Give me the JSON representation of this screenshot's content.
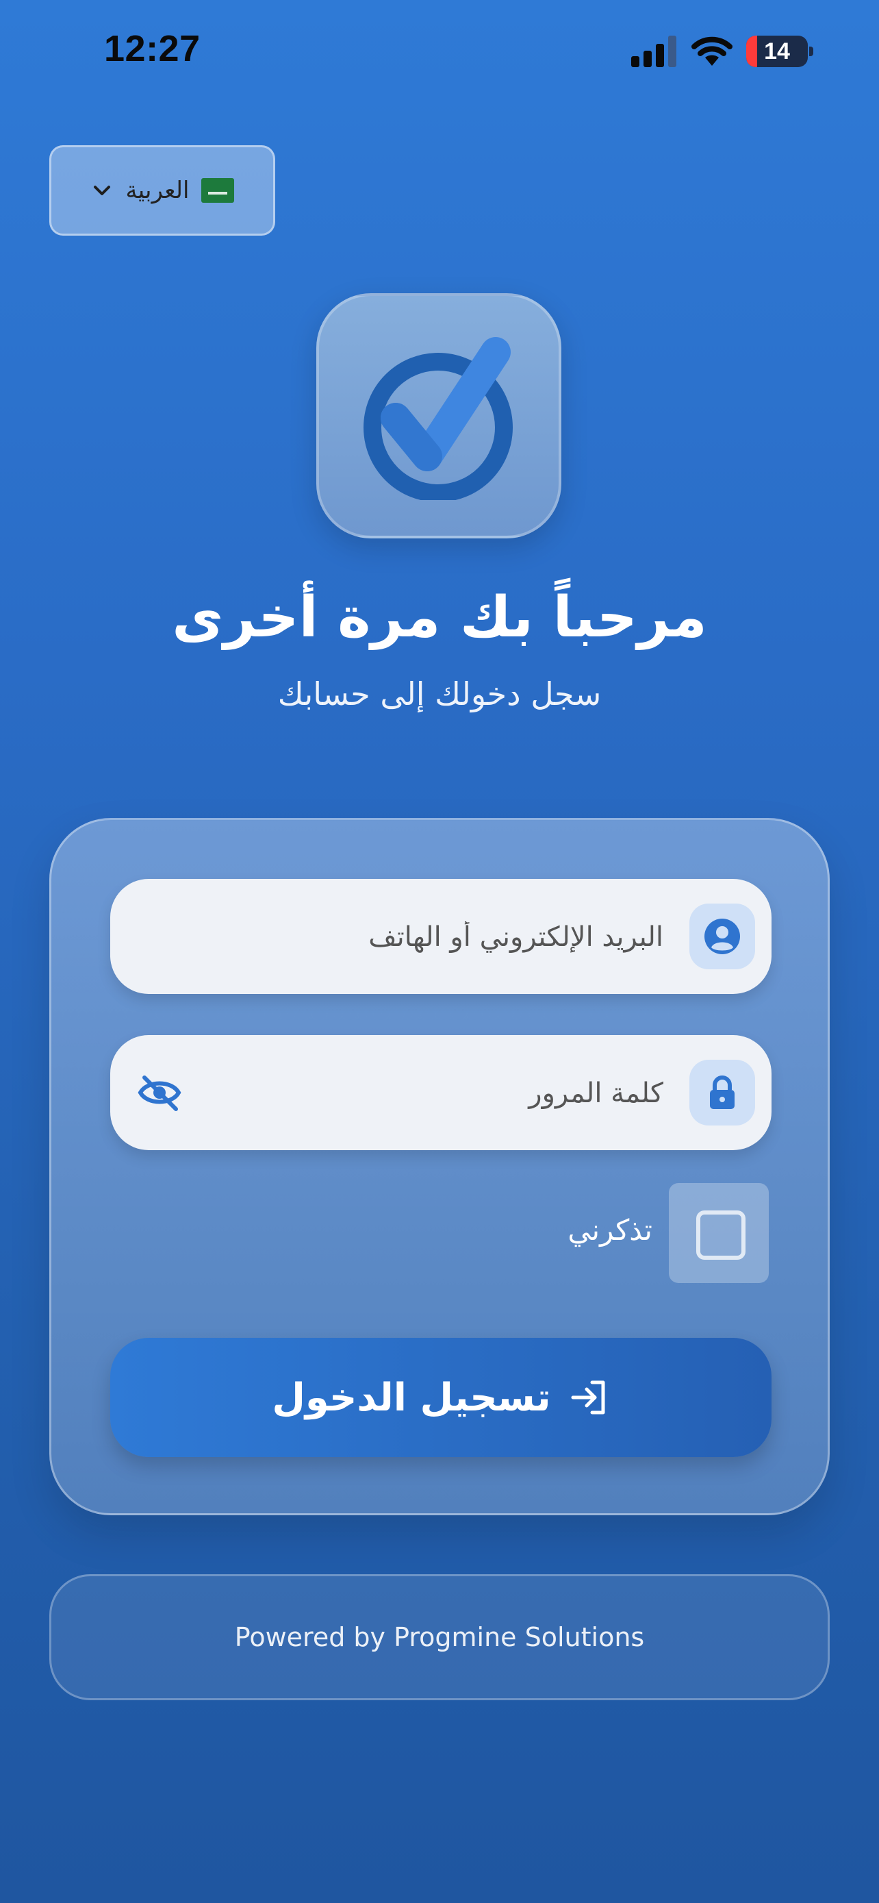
{
  "status_bar": {
    "time": "12:27",
    "battery": "14"
  },
  "language": {
    "label": "العربية",
    "flag": "saudi-flag"
  },
  "header": {
    "title": "مرحباً بك مرة أخرى",
    "subtitle": "سجل دخولك إلى حسابك"
  },
  "form": {
    "email_placeholder": "البريد الإلكتروني أو الهاتف",
    "password_placeholder": "كلمة المرور",
    "remember_label": "تذكرني",
    "login_label": "تسجيل الدخول"
  },
  "footer": {
    "text": "Powered by Progmine Solutions"
  },
  "colors": {
    "primary": "#2f7ad6",
    "primary_dark": "#2560b4",
    "field_bg": "#eff2f7",
    "icon_bg": "#cfe0f7"
  }
}
